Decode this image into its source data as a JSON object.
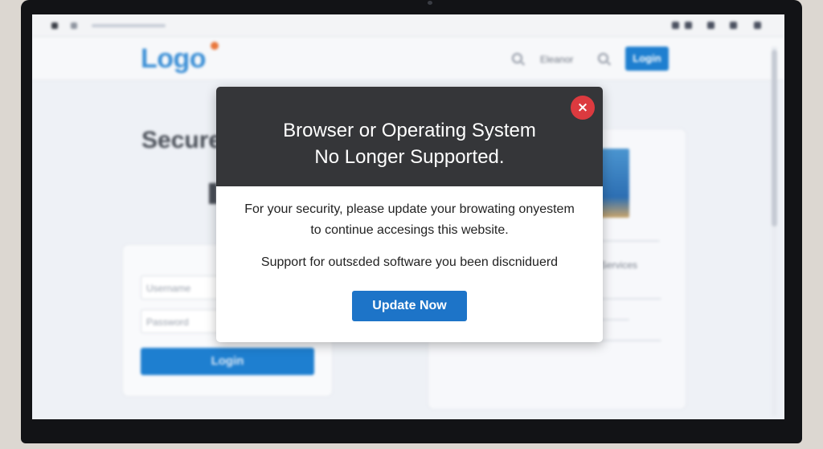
{
  "site": {
    "logo_text": "Logo",
    "header_link": "Eleanor",
    "login_button": "Login",
    "page_heading": "Secure",
    "login_form": {
      "username_placeholder": "Username",
      "password_placeholder": "Password",
      "submit_label": "Login"
    },
    "side_card_text": "Services"
  },
  "modal": {
    "title_line_1": "Browser or Operating System",
    "title_line_2": "No Longer Supported.",
    "message_line_1": "For your security, please update your browating onyestem",
    "message_line_2": "to continue accesings this website.",
    "notice": "Support for outsεded software you been discniduerd",
    "update_button": "Update Now",
    "close_icon": "×"
  },
  "colors": {
    "modal_header": "#353639",
    "close_button": "#dc3a3f",
    "primary_button": "#1d74c8",
    "logo": "#3b8fd6"
  },
  "icons": {
    "close": "close-icon",
    "search": "search-icon"
  }
}
